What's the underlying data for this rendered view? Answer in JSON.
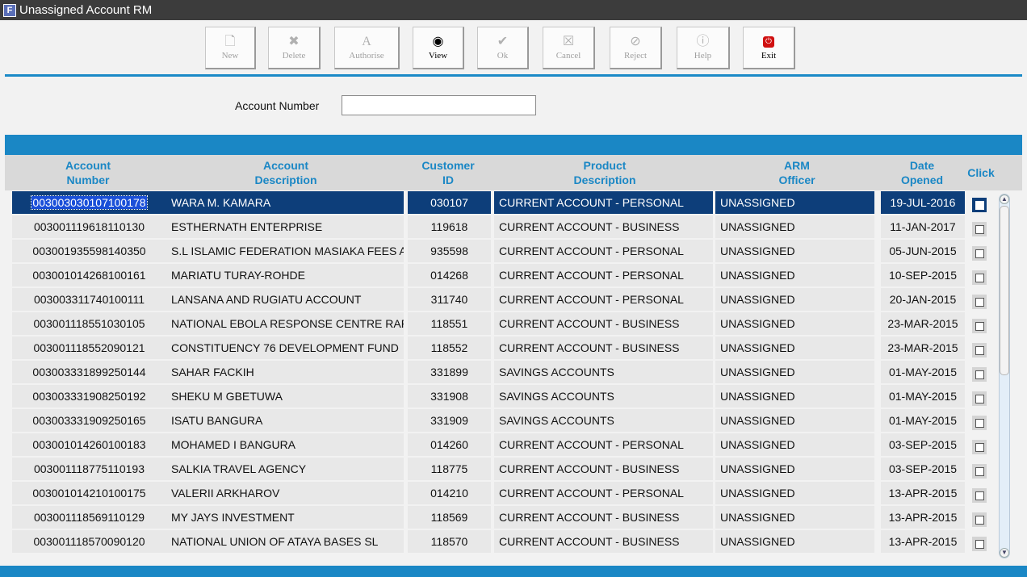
{
  "window": {
    "title": "Unassigned Account RM"
  },
  "toolbar": {
    "new": "New",
    "delete": "Delete",
    "authorise": "Authorise",
    "view": "View",
    "ok": "Ok",
    "cancel": "Cancel",
    "reject": "Reject",
    "help": "Help",
    "exit": "Exit"
  },
  "filter": {
    "label": "Account Number",
    "value": ""
  },
  "table": {
    "headers": {
      "account_number": "Account\nNumber",
      "account_description": "Account\nDescription",
      "customer_id": "Customer\nID",
      "product_description": "Product\nDescription",
      "arm_officer": "ARM\nOfficer",
      "date_opened": "Date\nOpened",
      "click": "Click"
    },
    "rows": [
      {
        "account_number": "003003030107100178",
        "description": "WARA M. KAMARA",
        "customer_id": "030107",
        "product": "CURRENT ACCOUNT - PERSONAL",
        "arm_officer": "UNASSIGNED",
        "date_opened": "19-JUL-2016"
      },
      {
        "account_number": "003001119618110130",
        "description": "ESTHERNATH ENTERPRISE",
        "customer_id": "119618",
        "product": "CURRENT ACCOUNT - BUSINESS",
        "arm_officer": "UNASSIGNED",
        "date_opened": "11-JAN-2017"
      },
      {
        "account_number": "003001935598140350",
        "description": "S.L ISLAMIC FEDERATION MASIAKA FEES A/C",
        "customer_id": "935598",
        "product": "CURRENT ACCOUNT - PERSONAL",
        "arm_officer": "UNASSIGNED",
        "date_opened": "05-JUN-2015"
      },
      {
        "account_number": "003001014268100161",
        "description": "MARIATU TURAY-ROHDE",
        "customer_id": "014268",
        "product": "CURRENT ACCOUNT - PERSONAL",
        "arm_officer": "UNASSIGNED",
        "date_opened": "10-SEP-2015"
      },
      {
        "account_number": "003003311740100111",
        "description": "LANSANA AND RUGIATU ACCOUNT",
        "customer_id": "311740",
        "product": "CURRENT ACCOUNT - PERSONAL",
        "arm_officer": "UNASSIGNED",
        "date_opened": "20-JAN-2015"
      },
      {
        "account_number": "003001118551030105",
        "description": "NATIONAL EBOLA RESPONSE CENTRE RAPID",
        "customer_id": "118551",
        "product": "CURRENT ACCOUNT - BUSINESS",
        "arm_officer": "UNASSIGNED",
        "date_opened": "23-MAR-2015"
      },
      {
        "account_number": "003001118552090121",
        "description": "CONSTITUENCY 76 DEVELOPMENT FUND",
        "customer_id": "118552",
        "product": "CURRENT ACCOUNT - BUSINESS",
        "arm_officer": "UNASSIGNED",
        "date_opened": "23-MAR-2015"
      },
      {
        "account_number": "003003331899250144",
        "description": "SAHAR FACKIH",
        "customer_id": "331899",
        "product": "SAVINGS ACCOUNTS",
        "arm_officer": "UNASSIGNED",
        "date_opened": "01-MAY-2015"
      },
      {
        "account_number": "003003331908250192",
        "description": "SHEKU M GBETUWA",
        "customer_id": "331908",
        "product": "SAVINGS ACCOUNTS",
        "arm_officer": "UNASSIGNED",
        "date_opened": "01-MAY-2015"
      },
      {
        "account_number": "003003331909250165",
        "description": "ISATU BANGURA",
        "customer_id": "331909",
        "product": "SAVINGS ACCOUNTS",
        "arm_officer": "UNASSIGNED",
        "date_opened": "01-MAY-2015"
      },
      {
        "account_number": "003001014260100183",
        "description": "MOHAMED I BANGURA",
        "customer_id": "014260",
        "product": "CURRENT ACCOUNT - PERSONAL",
        "arm_officer": "UNASSIGNED",
        "date_opened": "03-SEP-2015"
      },
      {
        "account_number": "003001118775110193",
        "description": "SALKIA TRAVEL AGENCY",
        "customer_id": "118775",
        "product": "CURRENT ACCOUNT - BUSINESS",
        "arm_officer": "UNASSIGNED",
        "date_opened": "03-SEP-2015"
      },
      {
        "account_number": "003001014210100175",
        "description": "VALERII ARKHAROV",
        "customer_id": "014210",
        "product": "CURRENT ACCOUNT - PERSONAL",
        "arm_officer": "UNASSIGNED",
        "date_opened": "13-APR-2015"
      },
      {
        "account_number": "003001118569110129",
        "description": "MY JAYS INVESTMENT",
        "customer_id": "118569",
        "product": "CURRENT ACCOUNT - BUSINESS",
        "arm_officer": "UNASSIGNED",
        "date_opened": "13-APR-2015"
      },
      {
        "account_number": "003001118570090120",
        "description": "NATIONAL UNION OF ATAYA BASES SL",
        "customer_id": "118570",
        "product": "CURRENT ACCOUNT - BUSINESS",
        "arm_officer": "UNASSIGNED",
        "date_opened": "13-APR-2015"
      }
    ],
    "selected_row": 0
  },
  "colors": {
    "accent": "#1a87c5",
    "selection": "#0d3e7a",
    "titlebar": "#3c3c3c"
  }
}
